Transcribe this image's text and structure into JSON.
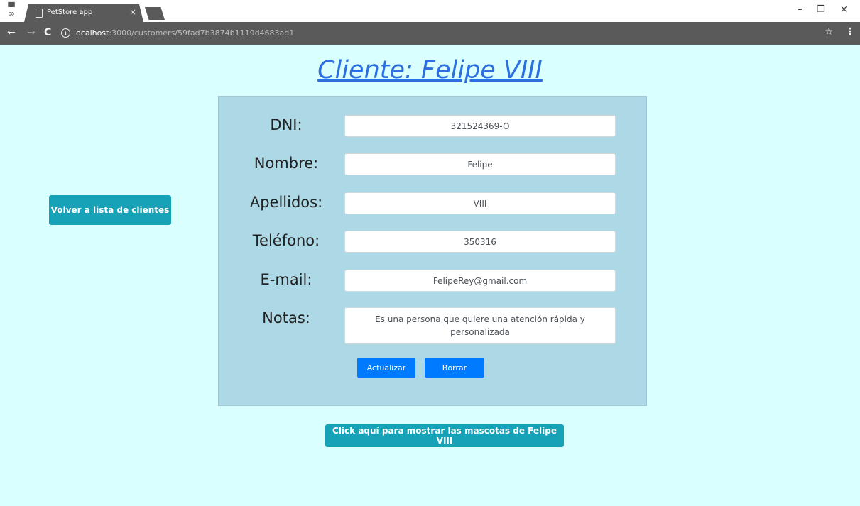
{
  "browser": {
    "tab_title": "PetStore app",
    "tab_close": "×",
    "url_host": "localhost",
    "url_path": ":3000/customers/59fad7b3874b1119d4683ad1",
    "info_glyph": "i",
    "back_glyph": "←",
    "forward_glyph": "→",
    "reload_glyph": "C",
    "star_glyph": "☆",
    "menu_glyph": "⋮",
    "minimize_glyph": "–",
    "restore_glyph": "❐",
    "close_glyph": "×",
    "incognito_glyph": "▀\n∞"
  },
  "page": {
    "title": "Cliente: Felipe VIII",
    "back_button": "Volver a lista de clientes",
    "pets_button": "Click aquí para mostrar las mascotas de Felipe VIII"
  },
  "form": {
    "dni": {
      "label": "DNI:",
      "value": "321524369-O"
    },
    "nombre": {
      "label": "Nombre:",
      "value": "Felipe"
    },
    "apellidos": {
      "label": "Apellidos:",
      "value": "VIII"
    },
    "telefono": {
      "label": "Teléfono:",
      "value": "350316"
    },
    "email": {
      "label": "E-mail:",
      "value": "FelipeRey@gmail.com"
    },
    "notas": {
      "label": "Notas:",
      "value": "Es una persona que quiere una atención rápida y personalizada"
    },
    "update_button": "Actualizar",
    "delete_button": "Borrar"
  },
  "colors": {
    "page_background": "#daffff",
    "card_background": "#add8e6",
    "title_link": "#2b6fe0",
    "teal_button": "#17a2b8",
    "primary_button": "#007bff",
    "browser_toolbar": "#5a5a5a"
  }
}
